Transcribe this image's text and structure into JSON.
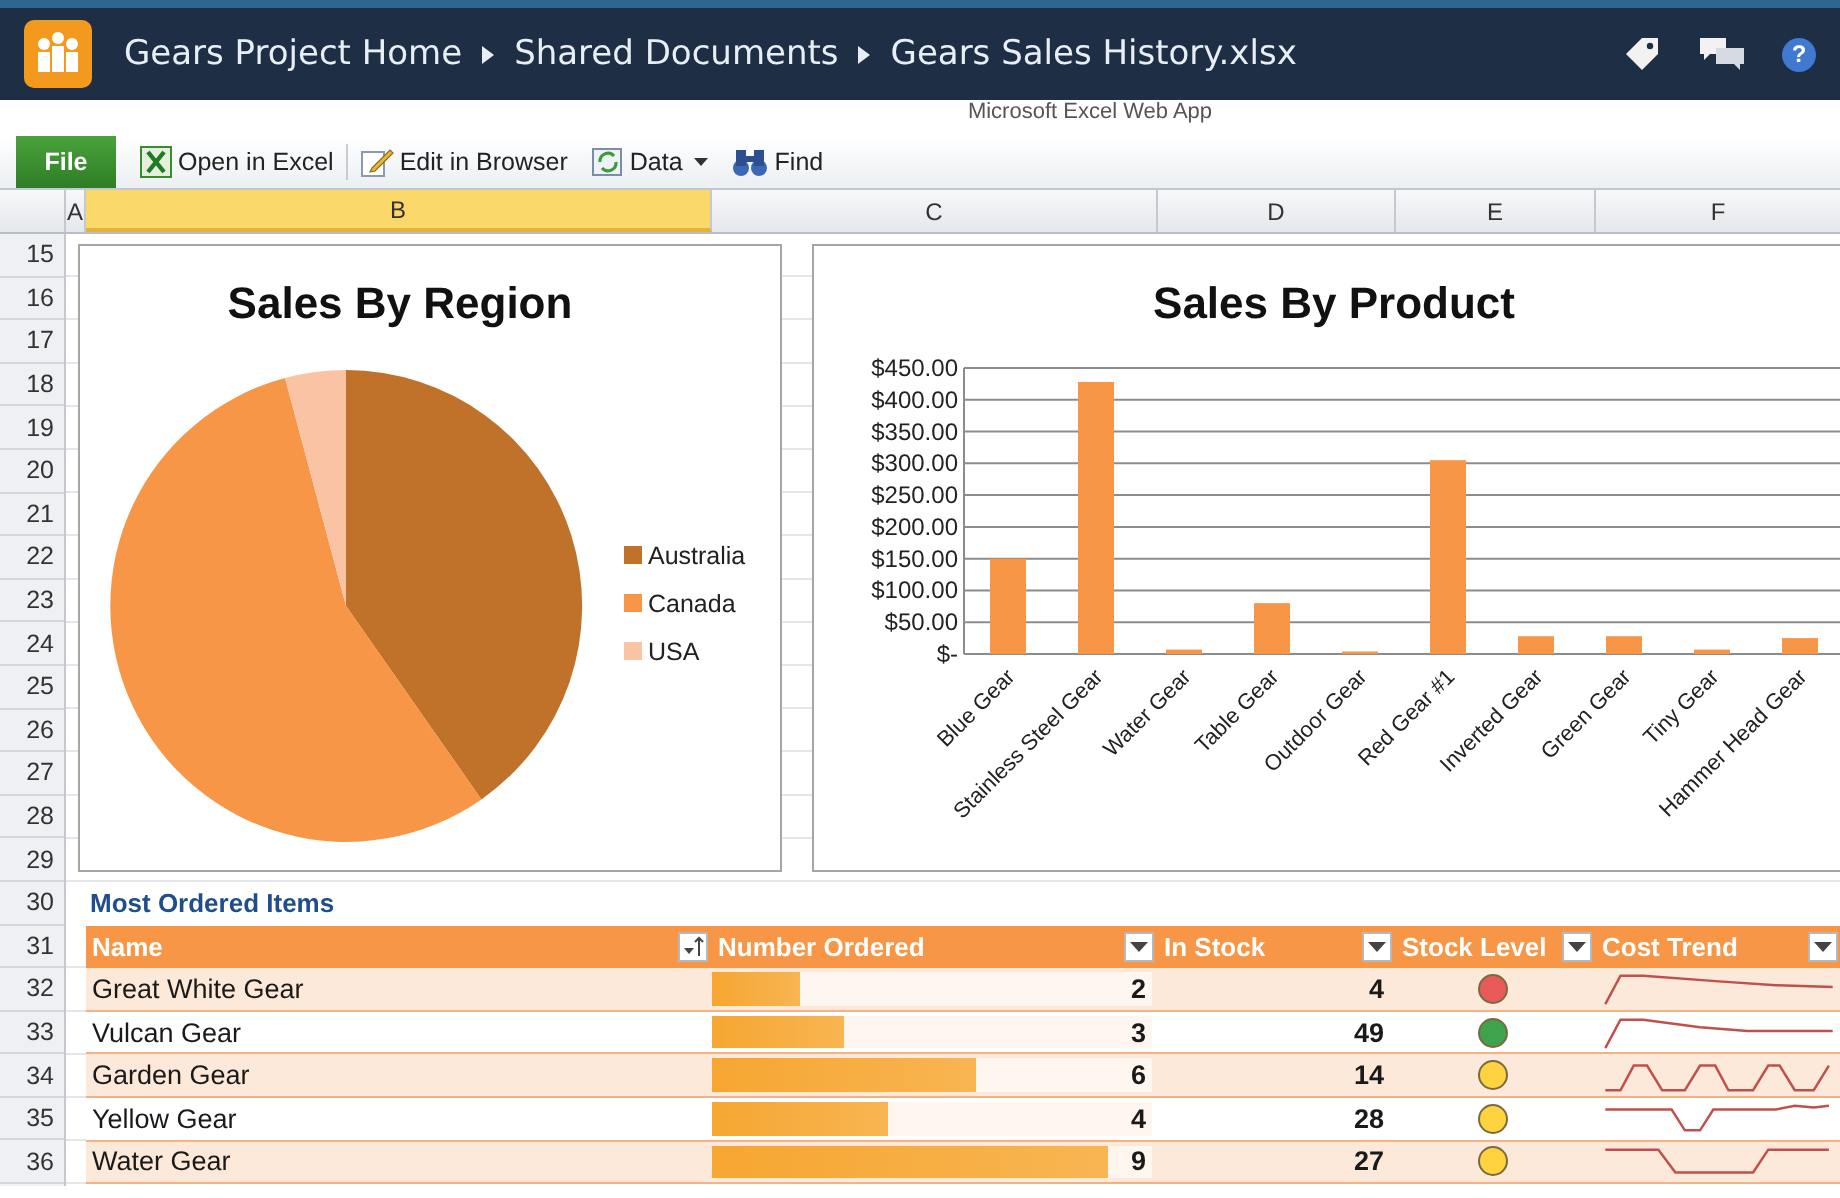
{
  "header": {
    "breadcrumbs": [
      "Gears Project Home",
      "Shared Documents",
      "Gears Sales History.xlsx"
    ],
    "help": "?"
  },
  "app_title": "Microsoft Excel Web App",
  "toolbar": [
    {
      "kind": "file",
      "label": "File"
    },
    {
      "kind": "excel",
      "label": "Open in Excel"
    },
    {
      "kind": "edit",
      "label": "Edit in Browser"
    },
    {
      "kind": "data",
      "label": "Data"
    },
    {
      "kind": "find",
      "label": "Find"
    }
  ],
  "columns": [
    {
      "label": "A",
      "selected": false
    },
    {
      "label": "B",
      "selected": true
    },
    {
      "label": "C",
      "selected": false
    },
    {
      "label": "D",
      "selected": false
    },
    {
      "label": "E",
      "selected": false
    },
    {
      "label": "F",
      "selected": false
    }
  ],
  "row_numbers": [
    "15",
    "16",
    "17",
    "18",
    "19",
    "20",
    "21",
    "22",
    "23",
    "24",
    "25",
    "26",
    "27",
    "28",
    "29",
    "30",
    "31",
    "32",
    "33",
    "34",
    "35",
    "36"
  ],
  "region_chart": {
    "title": "Sales By Region",
    "legend": [
      {
        "label": "Australia",
        "color": "#c0712a"
      },
      {
        "label": "Canada",
        "color": "#f79646"
      },
      {
        "label": "USA",
        "color": "#fac4a4"
      }
    ]
  },
  "product_chart": {
    "chart_data": {
      "type": "bar",
      "title": "Sales By Product",
      "categories": [
        "Blue Gear",
        "Stainless Steel Gear",
        "Water Gear",
        "Table Gear",
        "Outdoor Gear",
        "Red Gear #1",
        "Inverted Gear",
        "Green Gear",
        "Tiny Gear",
        "Hammer Head Gear"
      ],
      "values": [
        150,
        428,
        7,
        80,
        4,
        305,
        28,
        28,
        7,
        25
      ],
      "ylim": [
        0,
        450
      ],
      "grid": true,
      "yticks": [
        {
          "value": 0,
          "label": "$-"
        },
        {
          "value": 50,
          "label": "$50.00"
        },
        {
          "value": 100,
          "label": "$100.00"
        },
        {
          "value": 150,
          "label": "$150.00"
        },
        {
          "value": 200,
          "label": "$200.00"
        },
        {
          "value": 250,
          "label": "$250.00"
        },
        {
          "value": 300,
          "label": "$300.00"
        },
        {
          "value": 350,
          "label": "$350.00"
        },
        {
          "value": 400,
          "label": "$400.00"
        },
        {
          "value": 450,
          "label": "$450.00"
        }
      ]
    }
  },
  "table": {
    "title": "Most Ordered Items",
    "columns": [
      {
        "label": "Name",
        "kind": "sort"
      },
      {
        "label": "Number Ordered",
        "kind": "dropdown"
      },
      {
        "label": "In Stock",
        "kind": "dropdown"
      },
      {
        "label": "Stock Level",
        "kind": "dropdown"
      },
      {
        "label": "Cost Trend",
        "kind": "dropdown"
      }
    ],
    "rows": [
      {
        "name": "Great White Gear",
        "ordered": "2",
        "level": 0.2,
        "in_stock": "4",
        "color": "#e85a5a"
      },
      {
        "name": "Vulcan Gear",
        "ordered": "3",
        "level": 0.3,
        "in_stock": "49",
        "color": "#3fa34d"
      },
      {
        "name": "Garden Gear",
        "ordered": "6",
        "level": 0.6,
        "in_stock": "14",
        "color": "#ffd23f"
      },
      {
        "name": "Yellow Gear",
        "ordered": "4",
        "level": 0.4,
        "in_stock": "28",
        "color": "#ffd23f"
      },
      {
        "name": "Water Gear",
        "ordered": "9",
        "level": 0.9,
        "in_stock": "27",
        "color": "#ffd23f"
      }
    ]
  }
}
